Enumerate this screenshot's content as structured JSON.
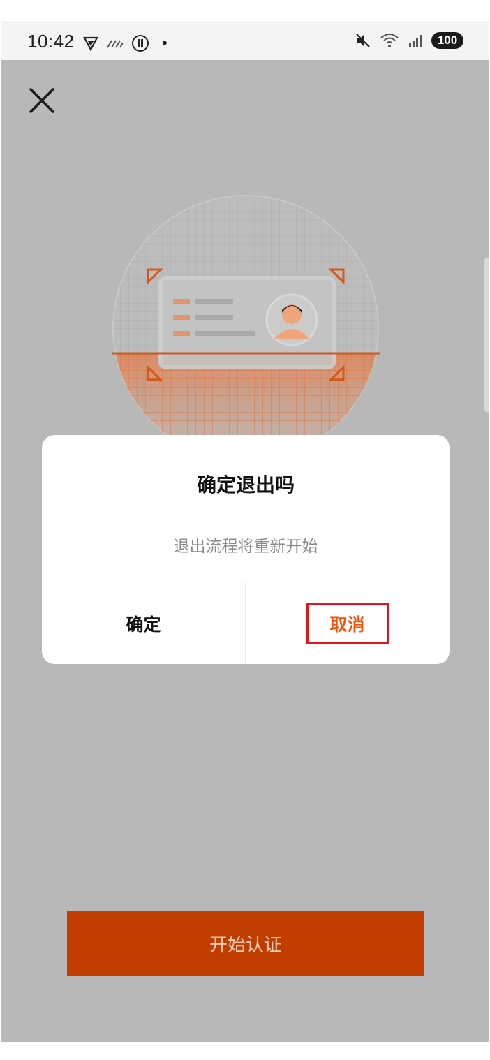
{
  "status_bar": {
    "time": "10:42",
    "dot": "•",
    "battery": "100",
    "icons": [
      "vpn-icon",
      "signal-off-icon",
      "record-icon",
      "mute-icon",
      "wifi-icon",
      "cell-signal-icon",
      "battery-icon"
    ]
  },
  "header": {
    "close_icon": "close-icon"
  },
  "illustration": {
    "name": "id-card-scan-illustration",
    "accent": "#ff6a1f"
  },
  "dialog": {
    "title": "确定退出吗",
    "message": "退出流程将重新开始",
    "confirm_label": "确定",
    "cancel_label": "取消",
    "cancel_highlight_color": "#e0161d",
    "cancel_text_color": "#ff4d05"
  },
  "footer": {
    "start_button_label": "开始认证",
    "start_button_color": "#c13d00"
  }
}
